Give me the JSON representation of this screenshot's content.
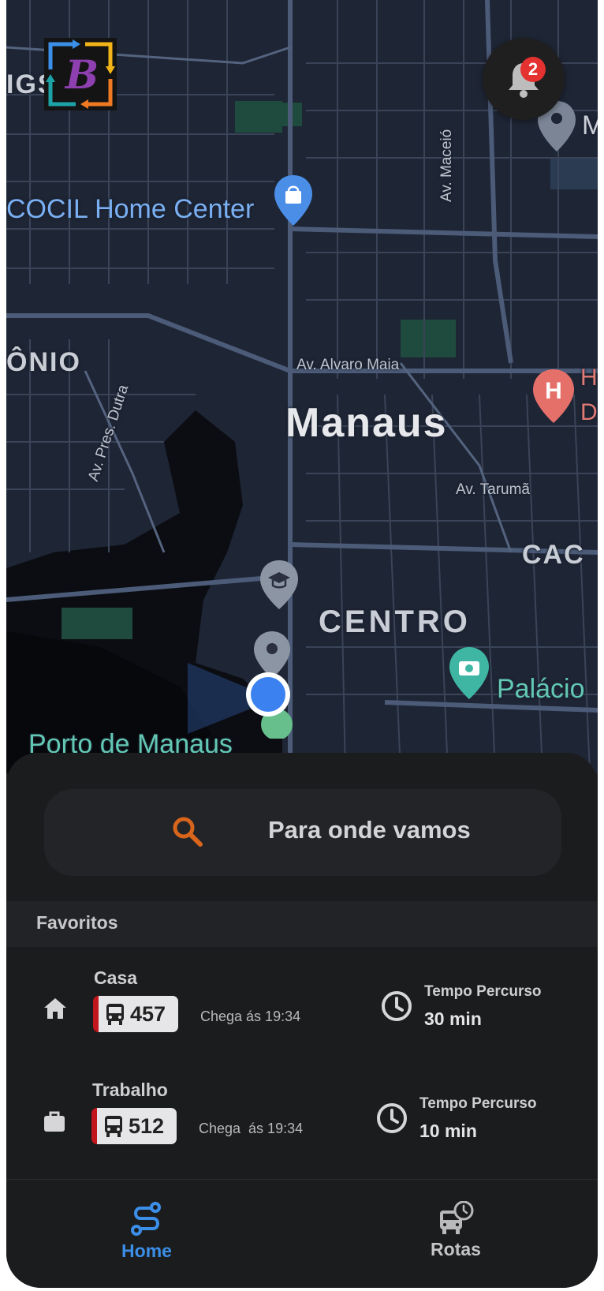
{
  "map": {
    "labels": {
      "city": "Manaus",
      "district": "CENTRO",
      "poi_home_center": "COCIL Home Center",
      "poi_palacio": "Palácio",
      "poi_porto": "Porto de Manaus",
      "street_alvaro_maia": "Av. Alvaro Maia",
      "street_maceio": "Av. Maceió",
      "street_taruma": "Av. Tarumã",
      "street_pres_dutra": "Av. Pres. Dutra",
      "area_left": "ÔNIO",
      "area_right": "CAC",
      "edge_igs": "IGS",
      "edge_m": "M",
      "edge_h": "H",
      "edge_d": "D",
      "hospital_letter": "H"
    }
  },
  "header": {
    "logo_icon": "app-logo-b-icon",
    "notifications": {
      "icon": "bell-icon",
      "count": "2"
    }
  },
  "search": {
    "placeholder": "Para onde vamos",
    "icon": "search-icon"
  },
  "favorites": {
    "header": "Favoritos",
    "items": [
      {
        "icon": "home-icon",
        "title": "Casa",
        "line": "457",
        "arrival": "Chega ás 19:34",
        "duration_label": "Tempo Percurso",
        "duration": "30 min"
      },
      {
        "icon": "briefcase-icon",
        "title": "Trabalho",
        "line": "512",
        "arrival": "Chega  ás 19:34",
        "duration_label": "Tempo Percurso",
        "duration": "10 min"
      }
    ]
  },
  "bottom_nav": {
    "items": [
      {
        "icon": "route-icon",
        "label": "Home",
        "active": true
      },
      {
        "icon": "bus-clock-icon",
        "label": "Rotas",
        "active": false
      }
    ]
  },
  "colors": {
    "accent": "#3b8fe8",
    "search_icon": "#d9651c",
    "badge": "#e3322f",
    "bus_chip_stripe": "#c2161d"
  }
}
